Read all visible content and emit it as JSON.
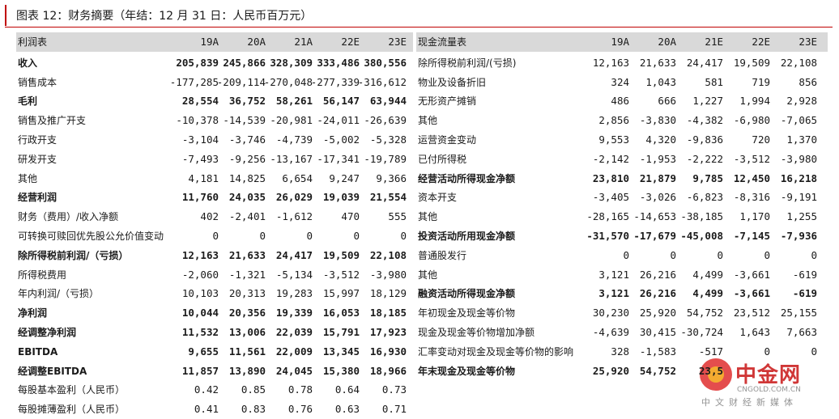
{
  "title": "图表 12：财务摘要（年结：12 月 31 日：人民币百万元）",
  "income": {
    "header": "利润表",
    "years": [
      "19A",
      "20A",
      "21A",
      "22E",
      "23E"
    ],
    "rows": [
      {
        "label": "收入",
        "bold": true,
        "values": [
          "205,839",
          "245,866",
          "328,309",
          "333,486",
          "380,556"
        ]
      },
      {
        "label": "销售成本",
        "bold": false,
        "values": [
          "-177,285",
          "-209,114",
          "-270,048",
          "-277,339",
          "-316,612"
        ]
      },
      {
        "label": "毛利",
        "bold": true,
        "values": [
          "28,554",
          "36,752",
          "58,261",
          "56,147",
          "63,944"
        ]
      },
      {
        "label": "销售及推广开支",
        "bold": false,
        "values": [
          "-10,378",
          "-14,539",
          "-20,981",
          "-24,011",
          "-26,639"
        ]
      },
      {
        "label": "行政开支",
        "bold": false,
        "values": [
          "-3,104",
          "-3,746",
          "-4,739",
          "-5,002",
          "-5,328"
        ]
      },
      {
        "label": "研发开支",
        "bold": false,
        "values": [
          "-7,493",
          "-9,256",
          "-13,167",
          "-17,341",
          "-19,789"
        ]
      },
      {
        "label": "其他",
        "bold": false,
        "values": [
          "4,181",
          "14,825",
          "6,654",
          "9,247",
          "9,366"
        ]
      },
      {
        "label": "经营利润",
        "bold": true,
        "values": [
          "11,760",
          "24,035",
          "26,029",
          "19,039",
          "21,554"
        ]
      },
      {
        "label": "财务（费用）/收入净额",
        "bold": false,
        "values": [
          "402",
          "-2,401",
          "-1,612",
          "470",
          "555"
        ]
      },
      {
        "label": "可转换可赎回优先股公允价值变动",
        "bold": false,
        "values": [
          "0",
          "0",
          "0",
          "0",
          "0"
        ]
      },
      {
        "label": "除所得税前利润/（亏损）",
        "bold": true,
        "values": [
          "12,163",
          "21,633",
          "24,417",
          "19,509",
          "22,108"
        ]
      },
      {
        "label": "所得税费用",
        "bold": false,
        "values": [
          "-2,060",
          "-1,321",
          "-5,134",
          "-3,512",
          "-3,980"
        ]
      },
      {
        "label": "年内利润/（亏损）",
        "bold": false,
        "values": [
          "10,103",
          "20,313",
          "19,283",
          "15,997",
          "18,129"
        ]
      },
      {
        "label": "净利润",
        "bold": true,
        "values": [
          "10,044",
          "20,356",
          "19,339",
          "16,053",
          "18,185"
        ]
      },
      {
        "label": "经调整净利润",
        "bold": true,
        "values": [
          "11,532",
          "13,006",
          "22,039",
          "15,791",
          "17,923"
        ]
      },
      {
        "label": "EBITDA",
        "bold": true,
        "values": [
          "9,655",
          "11,561",
          "22,009",
          "13,345",
          "16,930"
        ]
      },
      {
        "label": "经调整EBITDA",
        "bold": true,
        "values": [
          "11,857",
          "13,890",
          "24,045",
          "15,380",
          "18,966"
        ]
      },
      {
        "label": "每股基本盈利（人民币）",
        "bold": false,
        "values": [
          "0.42",
          "0.85",
          "0.78",
          "0.64",
          "0.73"
        ]
      },
      {
        "label": "每股摊薄盈利（人民币）",
        "bold": false,
        "values": [
          "0.41",
          "0.83",
          "0.76",
          "0.63",
          "0.71"
        ]
      }
    ]
  },
  "cashflow": {
    "header": "现金流量表",
    "years": [
      "19A",
      "20A",
      "21E",
      "22E",
      "23E"
    ],
    "rows": [
      {
        "label": "除所得税前利润/(亏损)",
        "bold": false,
        "values": [
          "12,163",
          "21,633",
          "24,417",
          "19,509",
          "22,108"
        ]
      },
      {
        "label": "物业及设备折旧",
        "bold": false,
        "values": [
          "324",
          "1,043",
          "581",
          "719",
          "856"
        ]
      },
      {
        "label": "无形资产摊销",
        "bold": false,
        "values": [
          "486",
          "666",
          "1,227",
          "1,994",
          "2,928"
        ]
      },
      {
        "label": "其他",
        "bold": false,
        "values": [
          "2,856",
          "-3,830",
          "-4,382",
          "-6,980",
          "-7,065"
        ]
      },
      {
        "label": "运营资金变动",
        "bold": false,
        "values": [
          "9,553",
          "4,320",
          "-9,836",
          "720",
          "1,370"
        ]
      },
      {
        "label": "已付所得税",
        "bold": false,
        "values": [
          "-2,142",
          "-1,953",
          "-2,222",
          "-3,512",
          "-3,980"
        ]
      },
      {
        "label": "经营活动所得现金净额",
        "bold": true,
        "values": [
          "23,810",
          "21,879",
          "9,785",
          "12,450",
          "16,218"
        ]
      },
      {
        "label": "资本开支",
        "bold": false,
        "values": [
          "-3,405",
          "-3,026",
          "-6,823",
          "-8,316",
          "-9,191"
        ]
      },
      {
        "label": "其他",
        "bold": false,
        "values": [
          "-28,165",
          "-14,653",
          "-38,185",
          "1,170",
          "1,255"
        ]
      },
      {
        "label": "投资活动所用现金净额",
        "bold": true,
        "values": [
          "-31,570",
          "-17,679",
          "-45,008",
          "-7,145",
          "-7,936"
        ]
      },
      {
        "label": "普通股发行",
        "bold": false,
        "values": [
          "0",
          "0",
          "0",
          "0",
          "0"
        ]
      },
      {
        "label": "其他",
        "bold": false,
        "values": [
          "3,121",
          "26,216",
          "4,499",
          "-3,661",
          "-619"
        ]
      },
      {
        "label": "融资活动所得现金净额",
        "bold": true,
        "values": [
          "3,121",
          "26,216",
          "4,499",
          "-3,661",
          "-619"
        ]
      },
      {
        "label": "年初现金及现金等价物",
        "bold": false,
        "values": [
          "30,230",
          "25,920",
          "54,752",
          "23,512",
          "25,155"
        ]
      },
      {
        "label": "现金及现金等价物增加净额",
        "bold": false,
        "values": [
          "-4,639",
          "30,415",
          "-30,724",
          "1,643",
          "7,663"
        ]
      },
      {
        "label": "汇率变动对现金及现金等价物的影响",
        "bold": false,
        "values": [
          "328",
          "-1,583",
          "-517",
          "0",
          "0"
        ]
      },
      {
        "label": "年末现金及现金等价物",
        "bold": true,
        "values": [
          "25,920",
          "54,752",
          "23,5",
          "",
          ""
        ]
      }
    ]
  },
  "watermark": {
    "brand": "中金网",
    "url": "CNGOLD.COM.CN",
    "tagline": "中文财经新媒体"
  }
}
